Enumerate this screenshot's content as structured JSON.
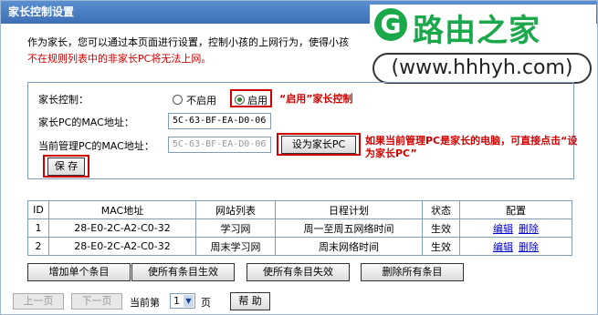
{
  "window": {
    "title": "家长控制设置"
  },
  "intro": {
    "line1": "作为家长，您可以通过本页面进行设置，控制小孩的上网行为，使得小孩",
    "line2": "不在规则列表中的非家长PC将无法上网。"
  },
  "watermark": {
    "logo_char": "G",
    "title": "路由之家",
    "url": "(www.hhhyh.com)"
  },
  "form": {
    "parental_control_label": "家长控制：",
    "option_off": "不启用",
    "option_on": "启用",
    "enable_note": "“启用”家长控制",
    "parent_mac_label": "家长PC的MAC地址：",
    "parent_mac_value": "5C-63-BF-EA-D0-06",
    "current_mac_label": "当前管理PC的MAC地址：",
    "current_mac_value": "5C-63-BF-EA-D0-06",
    "set_parent_button": "设为家长PC",
    "set_parent_note_1": "如果当前管理PC是家长的电脑，可直接点击“设",
    "set_parent_note_2": "为家长PC”",
    "save_button": "保 存"
  },
  "table": {
    "headers": [
      "ID",
      "MAC地址",
      "网站列表",
      "日程计划",
      "状态",
      "配置"
    ],
    "rows": [
      {
        "id": "1",
        "mac": "28-E0-2C-A2-C0-32",
        "site_list": "学习网",
        "schedule": "周一至周五网络时间",
        "status": "生效",
        "edit": "编辑",
        "delete": "删除"
      },
      {
        "id": "2",
        "mac": "28-E0-2C-A2-C0-32",
        "site_list": "周末学习网",
        "schedule": "周末网络时间",
        "status": "生效",
        "edit": "编辑",
        "delete": "删除"
      }
    ]
  },
  "actions": {
    "add_entry": "增加单个条目",
    "enable_all": "使所有条目生效",
    "disable_all": "使所有条目失效",
    "delete_all": "删除所有条目"
  },
  "pager": {
    "prev": "上一页",
    "next": "下一页",
    "current_page_label": "当前第",
    "page_value": "1",
    "page_suffix": "页",
    "help_button": "帮 助"
  },
  "colors": {
    "title_bar": "#4a7fc4",
    "warning_red": "#d00000",
    "brand_green": "#1aa84b"
  }
}
